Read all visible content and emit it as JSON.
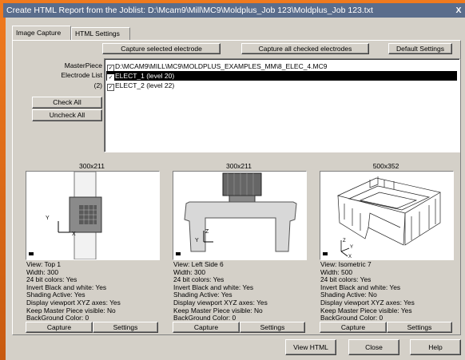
{
  "window": {
    "title": "Create HTML Report from the Joblist: D:\\Mcam9\\Mill\\MC9\\Moldplus_Job 123\\Moldplus_Job 123.txt",
    "close_label": "X"
  },
  "tabs": [
    {
      "label": "Image Capture",
      "active": true
    },
    {
      "label": "HTML Settings",
      "active": false
    }
  ],
  "toolbar": {
    "capture_selected_label": "Capture selected electrode",
    "capture_all_label": "Capture all checked electrodes",
    "default_settings_label": "Default Settings"
  },
  "form": {
    "masterpiece_label": "MasterPiece",
    "electrode_list_label": "Electrode List",
    "electrode_count": "(2)",
    "check_all_label": "Check All",
    "uncheck_all_label": "Uncheck All"
  },
  "electrode_list": [
    {
      "text": "D:\\MCAM9\\MILL\\MC9\\MOLDPLUS_EXAMPLES_MM\\8_ELEC_4.MC9",
      "checked": true,
      "selected": false
    },
    {
      "text": "ELECT_1 (level 20)",
      "checked": true,
      "selected": true
    },
    {
      "text": "ELECT_2 (level 22)",
      "checked": true,
      "selected": false
    }
  ],
  "previews": [
    {
      "size": "300x211",
      "info": [
        "View: Top 1",
        "Width: 300",
        "24 bit colors: Yes",
        "Invert Black and white: Yes",
        "Shading Active: Yes",
        "Display viewport XYZ axes: Yes",
        "Keep Master Piece visible: No",
        "BackGround Color: 0"
      ],
      "capture_label": "Capture",
      "settings_label": "Settings",
      "axis_labels": [
        "Y",
        "X"
      ]
    },
    {
      "size": "300x211",
      "info": [
        "View: Left Side 6",
        "Width: 300",
        "24 bit colors: Yes",
        "Invert Black and white: Yes",
        "Shading Active: Yes",
        "Display viewport XYZ axes: Yes",
        "Keep Master Piece visible: No",
        "BackGround Color: 0"
      ],
      "capture_label": "Capture",
      "settings_label": "Settings",
      "axis_labels": [
        "Z",
        "Y"
      ]
    },
    {
      "size": "500x352",
      "info": [
        "View: Isometric 7",
        "Width: 500",
        "24 bit colors: Yes",
        "Invert Black and white: Yes",
        "Shading Active: No",
        "Display viewport XYZ axes: Yes",
        "Keep Master Piece visible: Yes",
        "BackGround Color: 0"
      ],
      "capture_label": "Capture",
      "settings_label": "Settings",
      "axis_labels": [
        "Z",
        "Y",
        "X"
      ]
    }
  ],
  "footer": {
    "view_html_label": "View HTML",
    "close_label": "Close",
    "help_label": "Help"
  },
  "colors": {
    "frame_orange": "#e8701c",
    "title_bar": "#5a6d8c",
    "dialog_face": "#d4d0c8",
    "selection": "#000000"
  }
}
